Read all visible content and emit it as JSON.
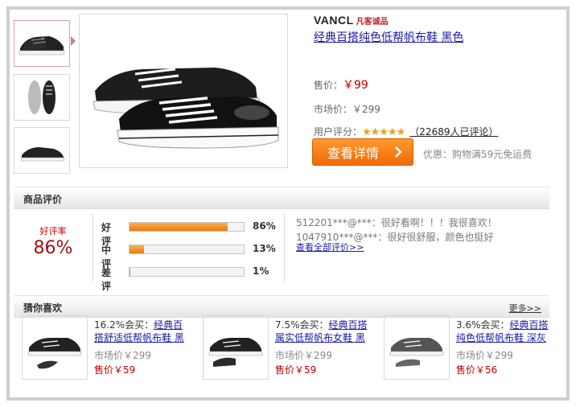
{
  "product": {
    "brand": "VANCL",
    "brand_sub": "凡客诚品",
    "title": "经典百搭纯色低帮帆布鞋 黑色",
    "sale_label": "售价：",
    "sale_price": "￥99",
    "market_label": "市场价：",
    "market_price": "￥299",
    "rating_label": "用户评分：",
    "stars": "★★★★★",
    "review_count": "（22689人已评论）",
    "detail_button": "查看详情",
    "promo": "优惠：购物满59元免运费"
  },
  "reviews_section": {
    "title": "商品评价",
    "good_rate_label": "好评率",
    "good_rate": "86%",
    "bars": [
      {
        "label": "好评",
        "percent_text": "86%",
        "value": 86
      },
      {
        "label": "中评",
        "percent_text": "13%",
        "value": 13
      },
      {
        "label": "差评",
        "percent_text": "1%",
        "value": 1
      }
    ],
    "comments": [
      "512201***@***：很好看啊！！！我很喜欢！",
      "1047910***@***：很好很舒服，颜色也挺好"
    ],
    "all_reviews_link": "查看全部评价>>"
  },
  "recommend": {
    "title": "猜你喜欢",
    "more": "更多>>",
    "items": [
      {
        "rate": "16.2%会买：",
        "name1": "经典百",
        "name2": "搭舒适低帮帆布鞋 黑",
        "market": "市场价￥299",
        "price": "售价￥59"
      },
      {
        "rate": "7.5%会买：",
        "name1": "经典百搭",
        "name2": "属实低帮帆布女鞋 黑",
        "market": "市场价￥299",
        "price": "售价￥59"
      },
      {
        "rate": "3.6%会买：",
        "name1": "经典百搭",
        "name2": "纯色低帮帆布鞋 深灰",
        "market": "市场价￥299",
        "price": "售价￥56"
      }
    ]
  },
  "colors": {
    "accent_orange": "#ef6a06",
    "price_red": "#c00000",
    "link_blue": "#1a1aa8",
    "star_gold": "#f0a010"
  }
}
